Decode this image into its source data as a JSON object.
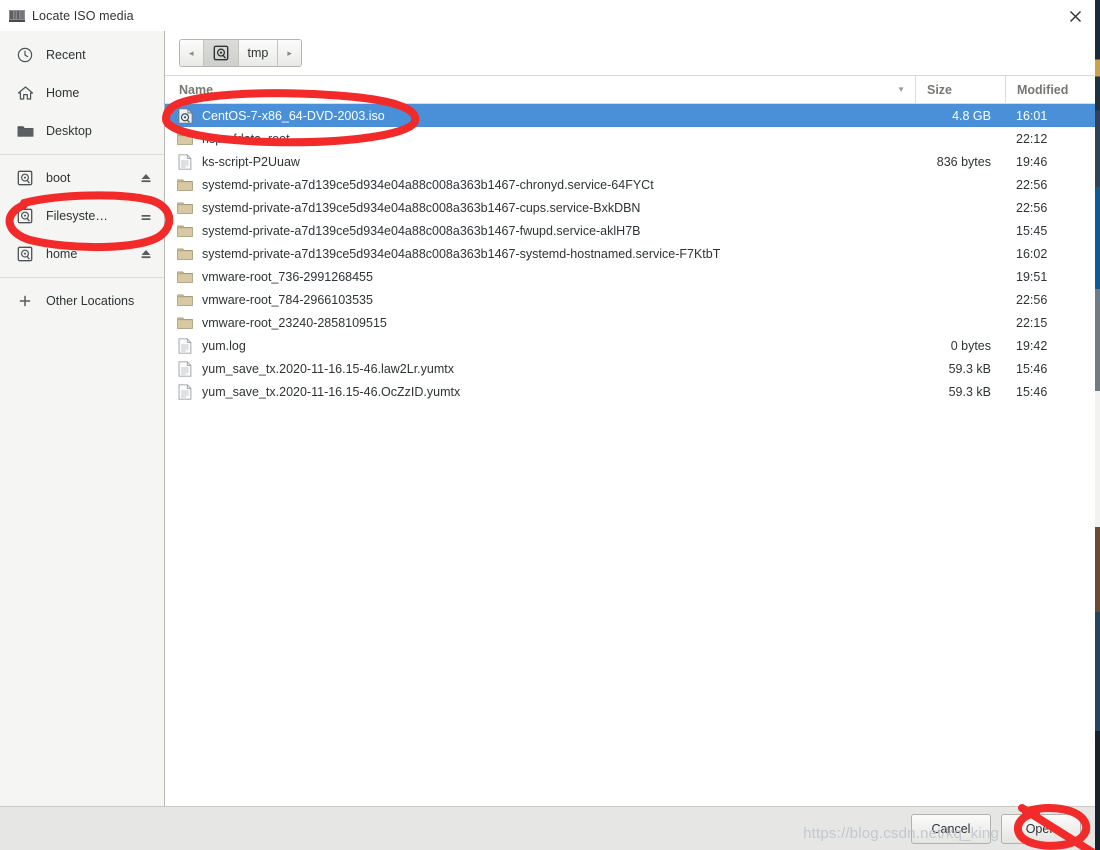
{
  "window": {
    "title": "Locate ISO media",
    "icon": "vmware-icon",
    "close_label": "×"
  },
  "sidebar": {
    "items": [
      {
        "label": "Recent",
        "icon": "clock-icon",
        "action": ""
      },
      {
        "label": "Home",
        "icon": "home-icon",
        "action": ""
      },
      {
        "label": "Desktop",
        "icon": "folder-icon",
        "action": ""
      },
      {
        "label": "boot",
        "icon": "disk-icon",
        "action": "eject-icon"
      },
      {
        "label": "Filesyste…",
        "icon": "disk-icon",
        "action": "unmount-icon"
      },
      {
        "label": "home",
        "icon": "disk-icon",
        "action": "eject-icon"
      },
      {
        "label": "Other Locations",
        "icon": "plus-icon",
        "action": ""
      }
    ]
  },
  "pathbar": {
    "back_label": "◂",
    "forward_label": "▸",
    "crumbs": [
      {
        "label": "",
        "icon": "disk-icon",
        "active": true
      },
      {
        "label": "tmp",
        "icon": "",
        "active": false
      }
    ]
  },
  "filelist": {
    "columns": [
      "Name",
      "Size",
      "Modified"
    ],
    "sort_caret": "▼",
    "rows": [
      {
        "name": "CentOS-7-x86_64-DVD-2003.iso",
        "icon": "iso-file-icon",
        "size": "4.8 GB",
        "modified": "16:01",
        "selected": true
      },
      {
        "name": "hsperfdata_root",
        "icon": "folder-icon",
        "size": "",
        "modified": "22:12",
        "selected": false
      },
      {
        "name": "ks-script-P2Uuaw",
        "icon": "text-file-icon",
        "size": "836 bytes",
        "modified": "19:46",
        "selected": false
      },
      {
        "name": "systemd-private-a7d139ce5d934e04a88c008a363b1467-chronyd.service-64FYCt",
        "icon": "folder-icon",
        "size": "",
        "modified": "22:56",
        "selected": false
      },
      {
        "name": "systemd-private-a7d139ce5d934e04a88c008a363b1467-cups.service-BxkDBN",
        "icon": "folder-icon",
        "size": "",
        "modified": "22:56",
        "selected": false
      },
      {
        "name": "systemd-private-a7d139ce5d934e04a88c008a363b1467-fwupd.service-aklH7B",
        "icon": "folder-icon",
        "size": "",
        "modified": "15:45",
        "selected": false
      },
      {
        "name": "systemd-private-a7d139ce5d934e04a88c008a363b1467-systemd-hostnamed.service-F7KtbT",
        "icon": "folder-icon",
        "size": "",
        "modified": "16:02",
        "selected": false
      },
      {
        "name": "vmware-root_736-2991268455",
        "icon": "folder-icon",
        "size": "",
        "modified": "19:51",
        "selected": false
      },
      {
        "name": "vmware-root_784-2966103535",
        "icon": "folder-icon",
        "size": "",
        "modified": "22:56",
        "selected": false
      },
      {
        "name": "vmware-root_23240-2858109515",
        "icon": "folder-icon",
        "size": "",
        "modified": "22:15",
        "selected": false
      },
      {
        "name": "yum.log",
        "icon": "text-file-icon",
        "size": "0 bytes",
        "modified": "19:42",
        "selected": false
      },
      {
        "name": "yum_save_tx.2020-11-16.15-46.law2Lr.yumtx",
        "icon": "text-file-icon",
        "size": "59.3 kB",
        "modified": "15:46",
        "selected": false
      },
      {
        "name": "yum_save_tx.2020-11-16.15-46.OcZzID.yumtx",
        "icon": "text-file-icon",
        "size": "59.3 kB",
        "modified": "15:46",
        "selected": false
      }
    ]
  },
  "actions": {
    "cancel_label": "Cancel",
    "open_label": "Open"
  },
  "watermark": {
    "text": "https://blog.csdn.net/kq_king"
  },
  "colors": {
    "selection": "#4a90d9",
    "annotation": "#f22a2a",
    "sidebar_bg": "#f5f5f3",
    "bottom_bar": "#e6e6e4"
  }
}
